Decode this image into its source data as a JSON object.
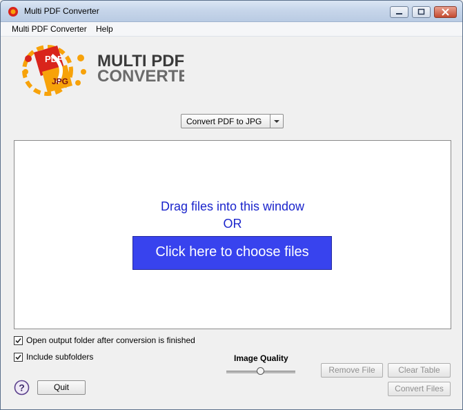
{
  "window": {
    "title": "Multi PDF Converter"
  },
  "menu": {
    "items": [
      "Multi PDF Converter",
      "Help"
    ]
  },
  "logo": {
    "line1": "MULTI PDF",
    "line2": "CONVERTER",
    "badge_top": "PDF",
    "badge_bottom": "JPG"
  },
  "mode_select": {
    "selected": "Convert PDF to JPG"
  },
  "drop_area": {
    "line1": "Drag files into this window",
    "line2": "OR",
    "choose_button": "Click here to choose files"
  },
  "options": {
    "open_output": {
      "label": "Open output folder after conversion is finished",
      "checked": true
    },
    "include_subfolders": {
      "label": "Include subfolders",
      "checked": true
    }
  },
  "quality": {
    "label": "Image Quality",
    "value_fraction": 0.5
  },
  "buttons": {
    "quit": "Quit",
    "remove_file": "Remove File",
    "clear_table": "Clear Table",
    "convert_files": "Convert Files"
  },
  "help_glyph": "?",
  "colors": {
    "accent_blue": "#3843ee",
    "drag_text": "#1a24cc",
    "logo_red": "#d9241b",
    "logo_orange": "#f7a20a"
  }
}
